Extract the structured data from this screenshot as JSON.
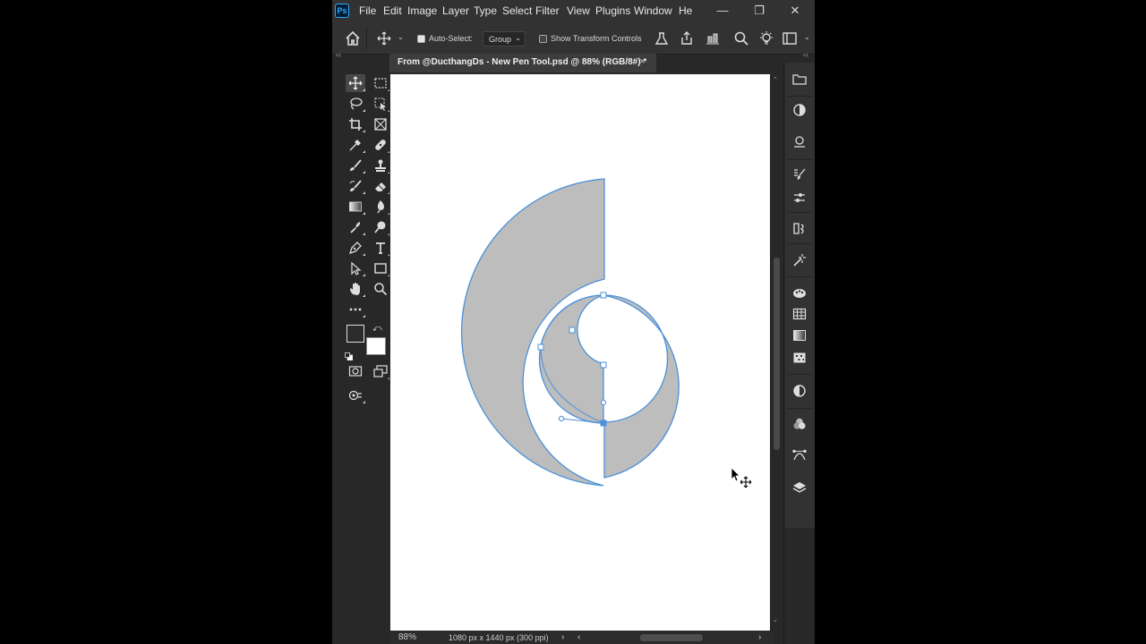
{
  "menubar": {
    "logo": "Ps",
    "items": [
      "File",
      "Edit",
      "Image",
      "Layer",
      "Type",
      "Select",
      "Filter",
      "View",
      "Plugins",
      "Window",
      "He"
    ]
  },
  "options_bar": {
    "auto_select_label": "Auto-Select:",
    "auto_select_value": "Group",
    "show_transform_label": "Show Transform Controls"
  },
  "document": {
    "tab_title": "From @DucthangDs - New Pen Tool.psd @ 88% (RGB/8#) *",
    "close_glyph": "×"
  },
  "status": {
    "zoom": "88%",
    "doc_info": "1080 px x 1440 px (300 ppi)"
  },
  "colors": {
    "accent": "#31a8ff",
    "path_stroke": "#4a90d9",
    "shape_fill": "#bdbdbd",
    "foreground": "#2b2b2b",
    "background": "#ffffff"
  },
  "tools": [
    "move",
    "marquee",
    "lasso",
    "object-select",
    "crop",
    "frame",
    "eyedropper",
    "healing",
    "brush",
    "stamp",
    "history-brush",
    "eraser",
    "gradient",
    "blur",
    "dodge",
    "burn",
    "pen",
    "type",
    "path-select",
    "rectangle",
    "hand",
    "zoom",
    "more"
  ],
  "panels": [
    "libraries",
    "adjust",
    "properties",
    "brush-settings",
    "brush",
    "clone-source",
    "actions",
    "color",
    "swatches",
    "gradients",
    "patterns",
    "adjustments",
    "channels",
    "paths",
    "layers"
  ]
}
